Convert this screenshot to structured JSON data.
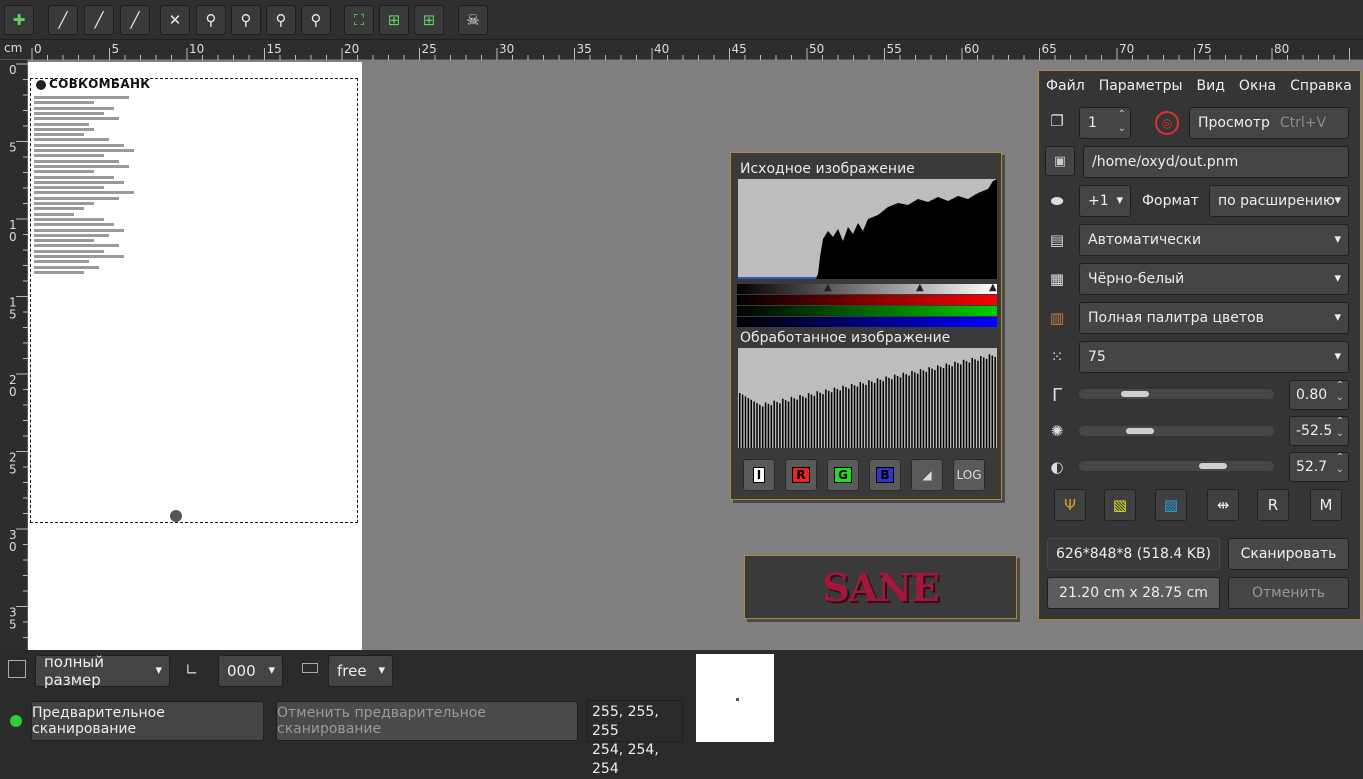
{
  "toolbar": {
    "icons": [
      "add-icon",
      "pipette-black-icon",
      "pipette-gray-icon",
      "pipette-white-icon",
      "zoom-undo-icon",
      "zoom-in-icon",
      "zoom-selection-icon",
      "zoom-out-icon",
      "zoom-full-icon",
      "select-area-icon",
      "autoselect-icon",
      "maximize-selection-icon",
      "skull-icon"
    ]
  },
  "ruler": {
    "unit": "cm",
    "top_labels": [
      "0",
      "5",
      "10",
      "15",
      "20",
      "25",
      "30",
      "35",
      "40",
      "45",
      "50",
      "55",
      "60",
      "65",
      "70",
      "75",
      "80",
      "85"
    ],
    "left_labels": [
      "0",
      "5",
      "10",
      "15",
      "20",
      "25",
      "30",
      "35"
    ]
  },
  "document": {
    "bank_name": "СОВКОМБАНК"
  },
  "histogram": {
    "source_title": "Исходное изображение",
    "processed_title": "Обработанное изображение",
    "buttons": [
      "I",
      "R",
      "G",
      "B",
      "",
      "LOG"
    ]
  },
  "sane_logo": "SANE",
  "menu": [
    "Файл",
    "Параметры",
    "Вид",
    "Окна",
    "Справка"
  ],
  "scan_panel": {
    "copies": "1",
    "preview_label": "Просмотр",
    "preview_shortcut": "Ctrl+V",
    "output_path": "/home/oxyd/out.pnm",
    "increment": "+1",
    "format_label": "Формат",
    "format_value": "по расширению",
    "source": "Автоматически",
    "mode": "Чёрно-белый",
    "palette": "Полная палитра цветов",
    "resolution": "75",
    "gamma": "0.80",
    "brightness": "-52.5",
    "contrast": "52.7",
    "image_info": "626*848*8 (518.4 KB)",
    "scan_button": "Сканировать",
    "size_info": "21.20 cm x 28.75 cm",
    "cancel_button": "Отменить",
    "slider_levels": {
      "gamma": 0.25,
      "brightness": 0.28,
      "contrast": 0.72
    }
  },
  "bottom": {
    "zoom": "полный размер",
    "rotation": "000",
    "ratio": "free",
    "preview_button": "Предварительное сканирование",
    "cancel_preview_button": "Отменить предварительное сканирование",
    "pixel_line1": "255, 255, 255",
    "pixel_line2": "254, 254, 254"
  },
  "colors": {
    "accent_border": "#b0892c",
    "status_green": "#2ecc40",
    "sane_red": "#a0183a"
  }
}
